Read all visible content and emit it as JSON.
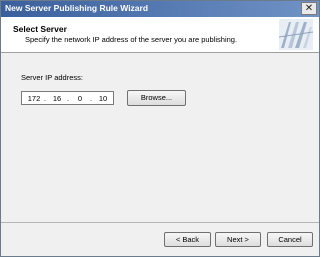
{
  "window": {
    "title": "New Server Publishing Rule Wizard"
  },
  "header": {
    "title": "Select Server",
    "subtitle": "Specify the network IP address of the server you are publishing.",
    "icon": "wizard-banner-icon"
  },
  "form": {
    "ip_label": "Server IP address:",
    "ip": {
      "o1": "172",
      "o2": "16",
      "o3": "0",
      "o4": "10",
      "sep": "."
    },
    "browse_label": "Browse..."
  },
  "footer": {
    "back_label": "< Back",
    "next_label": "Next >",
    "cancel_label": "Cancel"
  }
}
